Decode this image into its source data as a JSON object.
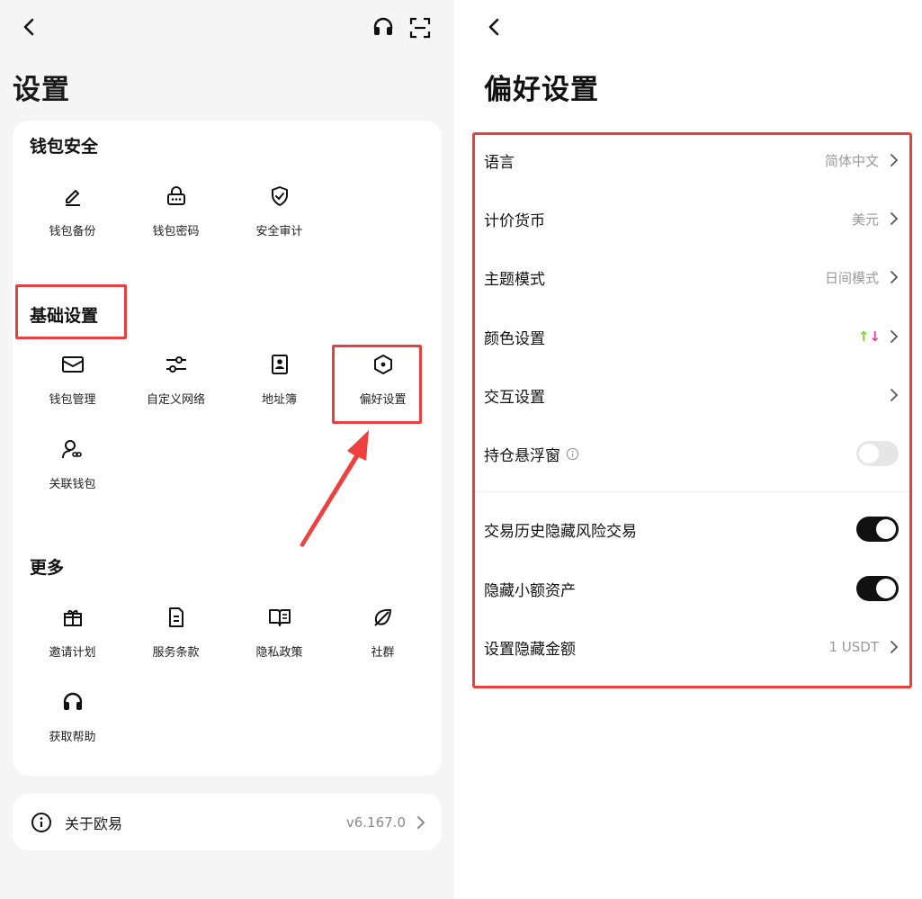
{
  "left": {
    "title": "设置",
    "sections": {
      "wallet_security": {
        "title": "钱包安全",
        "items": [
          {
            "label": "钱包备份",
            "icon": "pencil-icon"
          },
          {
            "label": "钱包密码",
            "icon": "lock-dots-icon"
          },
          {
            "label": "安全审计",
            "icon": "shield-check-icon"
          }
        ]
      },
      "basic": {
        "title": "基础设置",
        "items": [
          {
            "label": "钱包管理",
            "icon": "wallet-icon"
          },
          {
            "label": "自定义网络",
            "icon": "sliders-icon"
          },
          {
            "label": "地址簿",
            "icon": "address-book-icon"
          },
          {
            "label": "偏好设置",
            "icon": "hexagon-settings-icon"
          },
          {
            "label": "关联钱包",
            "icon": "user-link-icon"
          }
        ]
      },
      "more": {
        "title": "更多",
        "items": [
          {
            "label": "邀请计划",
            "icon": "gift-icon"
          },
          {
            "label": "服务条款",
            "icon": "document-icon"
          },
          {
            "label": "隐私政策",
            "icon": "book-icon"
          },
          {
            "label": "社群",
            "icon": "leaf-icon"
          },
          {
            "label": "获取帮助",
            "icon": "headset-icon"
          }
        ]
      }
    },
    "about": {
      "label": "关于欧易",
      "version": "v6.167.0"
    }
  },
  "right": {
    "title": "偏好设置",
    "rows": [
      {
        "label": "语言",
        "value": "简体中文"
      },
      {
        "label": "计价货币",
        "value": "美元"
      },
      {
        "label": "主题模式",
        "value": "日间模式"
      },
      {
        "label": "颜色设置",
        "up_arrow": "↑",
        "down_arrow": "↓",
        "up_color": "#7ed321",
        "down_color": "#e83e8c"
      },
      {
        "label": "交互设置"
      },
      {
        "label": "持仓悬浮窗",
        "toggle": false
      },
      {
        "label": "交易历史隐藏风险交易",
        "toggle": true
      },
      {
        "label": "隐藏小额资产",
        "toggle": true
      },
      {
        "label": "设置隐藏金额",
        "value": "1 USDT"
      }
    ]
  },
  "colors": {
    "highlight": "#e84040",
    "toggle_on": "#111111",
    "toggle_off": "#e6e6e6"
  }
}
